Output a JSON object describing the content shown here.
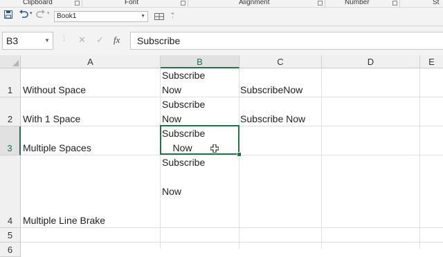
{
  "ribbon": {
    "groups": [
      "Clipboard",
      "Font",
      "Alignment",
      "Number",
      "St"
    ]
  },
  "quick_access": {
    "save_icon": "save-icon",
    "undo_icon": "undo-icon",
    "redo_icon": "redo-icon",
    "workbook_name": "Book1",
    "view_icon": "view-icon",
    "customize_icon": "customize-icon"
  },
  "formula_bar": {
    "name_box": "B3",
    "formula": "Subscribe",
    "cancel": "✕",
    "enter": "✓",
    "fx": "fx"
  },
  "grid": {
    "columns": [
      "A",
      "B",
      "C",
      "D",
      "E"
    ],
    "selected_column": "B",
    "rows": [
      {
        "num": "1",
        "a": "Without Space",
        "b": [
          "Subscribe",
          "Now"
        ],
        "c": "SubscribeNow"
      },
      {
        "num": "2",
        "a": "With 1 Space",
        "b": [
          "Subscribe",
          "Now"
        ],
        "c": "Subscribe Now"
      },
      {
        "num": "3",
        "a": "Multiple Spaces",
        "b": [
          "Subscribe",
          "    Now"
        ],
        "c": ""
      },
      {
        "num": "4",
        "a": "Multiple Line Brake",
        "b": [
          "Subscribe",
          "",
          "Now"
        ],
        "c": ""
      },
      {
        "num": "5",
        "a": "",
        "b": [],
        "c": ""
      },
      {
        "num": "6",
        "a": "",
        "b": [],
        "c": ""
      }
    ],
    "active_cell": "B3"
  },
  "colors": {
    "accent": "#217346"
  }
}
